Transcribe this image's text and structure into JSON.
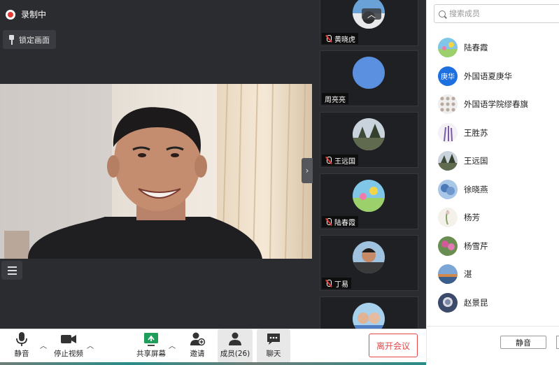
{
  "stage": {
    "recording_label": "录制中",
    "lock_label": "锁定画面"
  },
  "thumbnails": [
    {
      "name": "黄晓虎",
      "muted": true
    },
    {
      "name": "周亮亮",
      "muted": false
    },
    {
      "name": "王远国",
      "muted": true
    },
    {
      "name": "陆春霞",
      "muted": true
    },
    {
      "name": "丁易",
      "muted": true
    },
    {
      "name": "",
      "muted": false
    }
  ],
  "members_panel": {
    "search_placeholder": "搜索成员",
    "members": [
      {
        "name": "陆春霞",
        "avatar_text": ""
      },
      {
        "name": "外国语夏庚华",
        "avatar_text": "庚华"
      },
      {
        "name": "外国语学院缪春旗",
        "avatar_text": ""
      },
      {
        "name": "王胜苏",
        "avatar_text": ""
      },
      {
        "name": "王远国",
        "avatar_text": ""
      },
      {
        "name": "徐晓燕",
        "avatar_text": ""
      },
      {
        "name": "杨芳",
        "avatar_text": ""
      },
      {
        "name": "杨雪芹",
        "avatar_text": ""
      },
      {
        "name": "湛",
        "avatar_text": ""
      },
      {
        "name": "赵景昆",
        "avatar_text": ""
      }
    ],
    "mute_all_label": "静音"
  },
  "toolbar": {
    "mute_label": "静音",
    "stop_video_label": "停止视频",
    "share_screen_label": "共享屏幕",
    "invite_label": "邀请",
    "members_label": "成员(26)",
    "chat_label": "聊天",
    "leave_label": "离开会议"
  },
  "colors": {
    "stage_bg": "#2b2c30",
    "leave_red": "#e24a4a",
    "share_green": "#1e9e5a",
    "avatar_blue": "#1e6fe0"
  }
}
